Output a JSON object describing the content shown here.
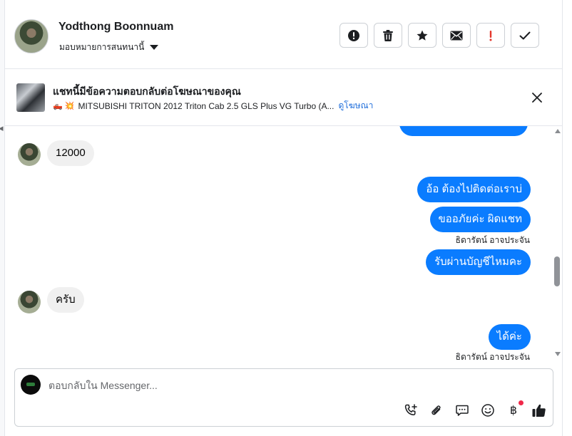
{
  "header": {
    "contact_name": "Yodthong Boonnuam",
    "assign_label": "มอบหมายการสนทนานี้"
  },
  "ad": {
    "title": "แชทนี้มีข้อความตอบกลับต่อโฆษณาของคุณ",
    "emoji": "🛻 💥",
    "description": "MITSUBISHI TRITON 2012 Triton Cab 2.5 GLS Plus VG Turbo (A...",
    "link": "ดูโฆษณา"
  },
  "messages": {
    "m1": "12000",
    "m2": "อ้อ ต้องไปติดต่อเราบ่",
    "m3": "ขออภัยค่ะ ผิดแชท",
    "m3_sender": "ธิดารัตน์ อาจประจัน",
    "m4": "รับผ่านบัญชีไหมคะ",
    "m5": "ครับ",
    "m6": "ได้ค่ะ",
    "m6_sender": "ธิดารัตน์ อาจประจัน"
  },
  "composer": {
    "placeholder": "ตอบกลับใน Messenger...",
    "baht_symbol": "฿"
  },
  "colors": {
    "outgoing_bubble": "#0a7cff",
    "incoming_bubble": "#f0f0f0",
    "accent_link": "#216fdb",
    "spam_icon": "#f02849"
  }
}
